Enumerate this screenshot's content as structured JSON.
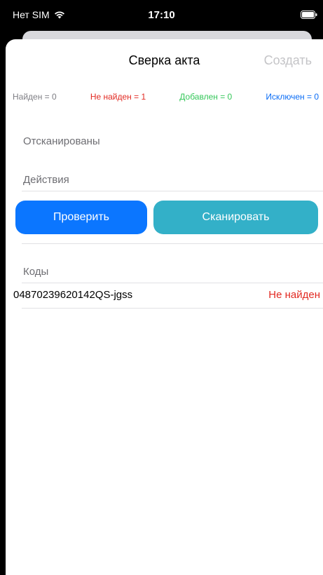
{
  "status_bar": {
    "carrier": "Нет SIM",
    "time": "17:10"
  },
  "nav": {
    "title": "Сверка акта",
    "create_label": "Создать"
  },
  "counters": {
    "found": "Найден = 0",
    "not_found": "Не найден = 1",
    "added": "Добавлен = 0",
    "excluded": "Исключен = 0"
  },
  "sections": {
    "scanned": "Отсканированы",
    "actions": "Действия",
    "codes": "Коды"
  },
  "buttons": {
    "check": "Проверить",
    "scan": "Сканировать"
  },
  "codes": [
    {
      "value": "04870239620142QS-jgss",
      "status": "Не найден"
    }
  ],
  "colors": {
    "primary_button": "#0b76ff",
    "scan_button": "#33b0c8",
    "not_found": "#e22a22",
    "added": "#34c759",
    "excluded": "#0a6cf5"
  }
}
